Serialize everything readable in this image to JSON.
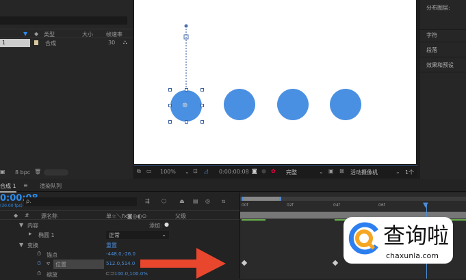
{
  "project": {
    "columns": {
      "type": "类型",
      "size": "大小",
      "framerate": "帧速率"
    },
    "item": {
      "name": "1",
      "type": "合成",
      "framerate": "30"
    },
    "bpc": "8 bpc"
  },
  "viewer": {
    "zoom": "100%",
    "timecode": "0:00:00:08",
    "quality": "完整",
    "camera": "活动摄像机",
    "views": "1个"
  },
  "right_panel": {
    "items": [
      "分布图层:",
      "字符",
      "段落",
      "效果和预设"
    ]
  },
  "timeline": {
    "tabs": [
      "合成 1",
      "渲染队列"
    ],
    "timecode": "0:00:08",
    "fps": "(30.00 fps)",
    "search_placeholder": "ρ.",
    "columns": {
      "source_name": "源名称",
      "parent": "父级",
      "switches": "单☆＼fx◙◎◐⊙"
    },
    "add_label": "添加:",
    "rows": [
      {
        "indent": 1,
        "toggle": "▼",
        "label": "内容"
      },
      {
        "indent": 2,
        "toggle": "▶",
        "label": "椭圆 1",
        "mode": "正常"
      },
      {
        "indent": 1,
        "toggle": "▼",
        "label": "变换",
        "value": "重置"
      },
      {
        "indent": 3,
        "label": "锚点",
        "value": "-448.0,-26.0"
      },
      {
        "indent": 3,
        "label": "位置",
        "value": "512.0,514.0"
      },
      {
        "indent": 3,
        "label": "缩放",
        "value": "100.0,100.0%"
      }
    ],
    "ruler": [
      "00f",
      "02f",
      "04f",
      "06f"
    ]
  },
  "watermark": {
    "name": "查询啦",
    "url": "chaxunla.com"
  }
}
